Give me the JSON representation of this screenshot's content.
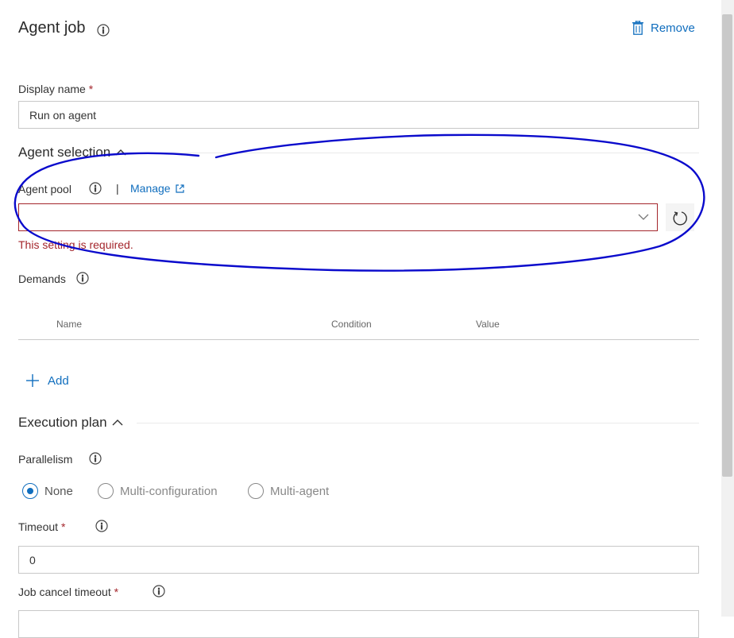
{
  "header": {
    "title": "Agent job",
    "remove_label": "Remove"
  },
  "display_name": {
    "label": "Display name",
    "required_mark": "*",
    "value": "Run on agent"
  },
  "agent_selection": {
    "title": "Agent selection",
    "pool_label": "Agent pool",
    "separator": "|",
    "manage_label": "Manage",
    "pool_value": "",
    "error": "This setting is required."
  },
  "demands": {
    "label": "Demands",
    "columns": [
      "Name",
      "Condition",
      "Value"
    ],
    "add_label": "Add"
  },
  "execution_plan": {
    "title": "Execution plan",
    "parallelism_label": "Parallelism",
    "options": [
      "None",
      "Multi-configuration",
      "Multi-agent"
    ],
    "selected": "None",
    "timeout_label": "Timeout",
    "timeout_required": "*",
    "timeout_value": "0",
    "cancel_timeout_label": "Job cancel timeout",
    "cancel_required": "*"
  },
  "colors": {
    "accent": "#106ebe",
    "error": "#a4262c",
    "annotation": "#0a0acc"
  }
}
